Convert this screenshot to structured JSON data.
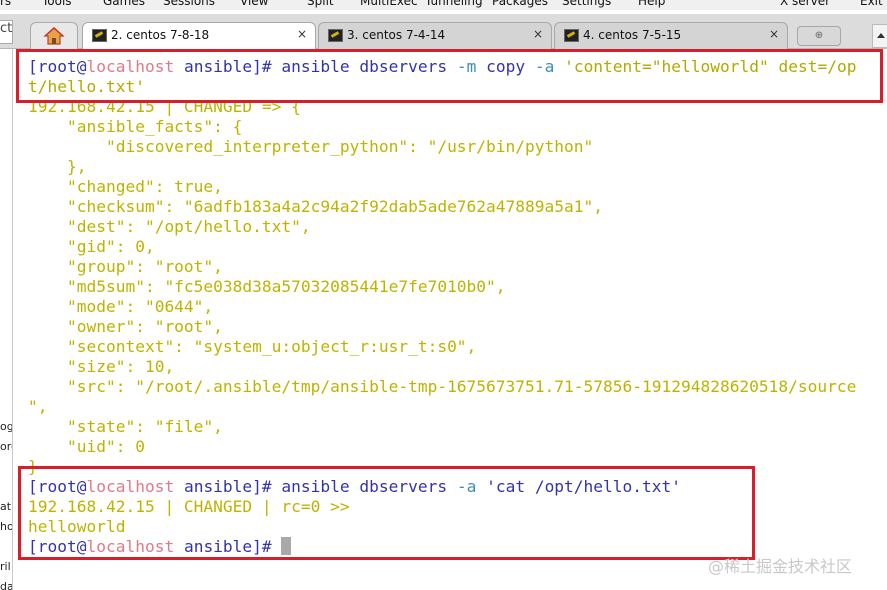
{
  "menubar": [
    "rs",
    "Tools",
    "Games",
    "Sessions",
    "View",
    "Split",
    "MultiExec",
    "Tunneling",
    "Packages",
    "Settings",
    "Help",
    "X server",
    "Exit"
  ],
  "left_field_text": "ct",
  "tabs": [
    {
      "label": "2. centos 7-8-18",
      "active": true
    },
    {
      "label": "3. centos 7-4-14",
      "active": false
    },
    {
      "label": "4. centos 7-5-15",
      "active": false
    }
  ],
  "tab_close_glyph": "×",
  "sidebar_fragments": [
    "og",
    "orc",
    "ath",
    "ho",
    "ril",
    "da"
  ],
  "terminal": {
    "prompt_open": "[root@",
    "host": "localhost",
    "prompt_close": " ansible]#",
    "cmd1": {
      "before_opt1": " ansible dbservers ",
      "opt1": "-m",
      "mid": " copy ",
      "opt2": "-a",
      "arg_line1": " 'content=\"helloworld\" dest=/op",
      "arg_line2": "t/hello.txt'"
    },
    "output1": [
      "192.168.42.15 | CHANGED => {",
      "    \"ansible_facts\": {",
      "        \"discovered_interpreter_python\": \"/usr/bin/python\"",
      "    },",
      "    \"changed\": true,",
      "    \"checksum\": \"6adfb183a4a2c94a2f92dab5ade762a47889a5a1\",",
      "    \"dest\": \"/opt/hello.txt\",",
      "    \"gid\": 0,",
      "    \"group\": \"root\",",
      "    \"md5sum\": \"fc5e038d38a57032085441e7fe7010b0\",",
      "    \"mode\": \"0644\",",
      "    \"owner\": \"root\",",
      "    \"secontext\": \"system_u:object_r:usr_t:s0\",",
      "    \"size\": 10,",
      "    \"src\": \"/root/.ansible/tmp/ansible-tmp-1675673751.71-57856-191294828620518/source",
      "\",",
      "    \"state\": \"file\",",
      "    \"uid\": 0",
      "}"
    ],
    "cmd2": {
      "before_opt": " ansible dbservers ",
      "opt": "-a",
      "arg": " 'cat /opt/hello.txt'"
    },
    "output2": [
      "192.168.42.15 | CHANGED | rc=0 >>",
      "helloworld"
    ]
  },
  "watermark": "@稀土掘金技术社区",
  "colors": {
    "highlight_box": "#d61f2b",
    "prompt": "#3333aa",
    "host": "#e07a8a",
    "option": "#3a8fb5",
    "output": "#bfb300"
  }
}
